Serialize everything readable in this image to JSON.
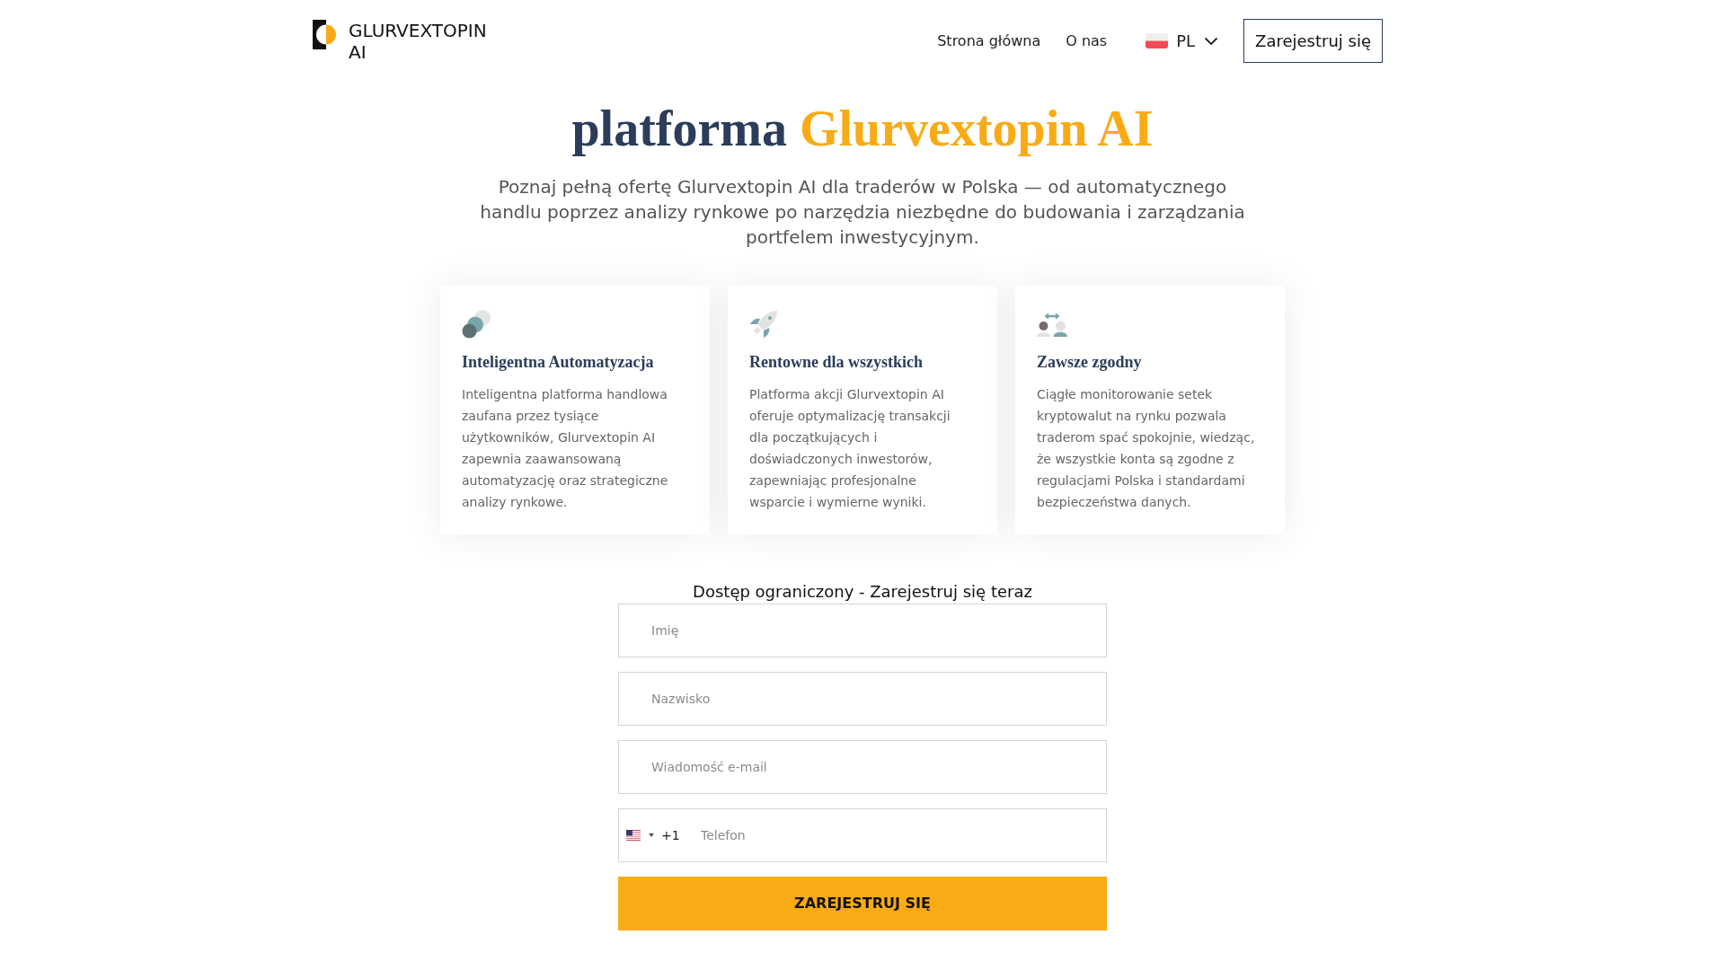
{
  "header": {
    "logo": {
      "text": "GLURVEXTOPIN AI"
    },
    "nav": [
      {
        "label": "Strona główna"
      },
      {
        "label": "O nas"
      }
    ],
    "language": {
      "code": "PL"
    },
    "register_button": "Zarejestruj się"
  },
  "hero": {
    "title": {
      "text": "platforma",
      "highlight": "Glurvextopin AI"
    },
    "subtitle": "Poznaj pełną ofertę Glurvextopin AI dla traderów w Polska — od automatycznego handlu poprzez analizy rynkowe po narzędzia niezbędne do budowania i zarządzania portfelem inwestycyjnym."
  },
  "features": [
    {
      "title": "Inteligentna Automatyzacja",
      "text": "Inteligentna platforma handlowa zaufana przez tysiące użytkowników, Glurvextopin AI zapewnia zaawansowaną automatyzację oraz strategiczne analizy rynkowe."
    },
    {
      "title": "Rentowne dla wszystkich",
      "text": "Platforma akcji Glurvextopin AI oferuje optymalizację transakcji dla początkujących i doświadczonych inwestorów, zapewniając profesjonalne wsparcie i wymierne wyniki."
    },
    {
      "title": "Zawsze zgodny",
      "text": "Ciągłe monitorowanie setek kryptowalut na rynku pozwala traderom spać spokojnie, wiedząc, że wszystkie konta są zgodne z regulacjami Polska i standardami bezpieczeństwa danych."
    }
  ],
  "form": {
    "heading": "Dostęp ograniczony - Zarejestruj się teraz",
    "fields": [
      {
        "kind": "text",
        "placeholder": "Imię"
      },
      {
        "kind": "text",
        "placeholder": "Nazwisko"
      },
      {
        "kind": "text",
        "placeholder": "Wiadomość e-mail"
      },
      {
        "kind": "phone",
        "dial_code": "+1",
        "placeholder": "Telefon"
      }
    ],
    "submit": "ZAREJESTRUJ SIĘ"
  }
}
